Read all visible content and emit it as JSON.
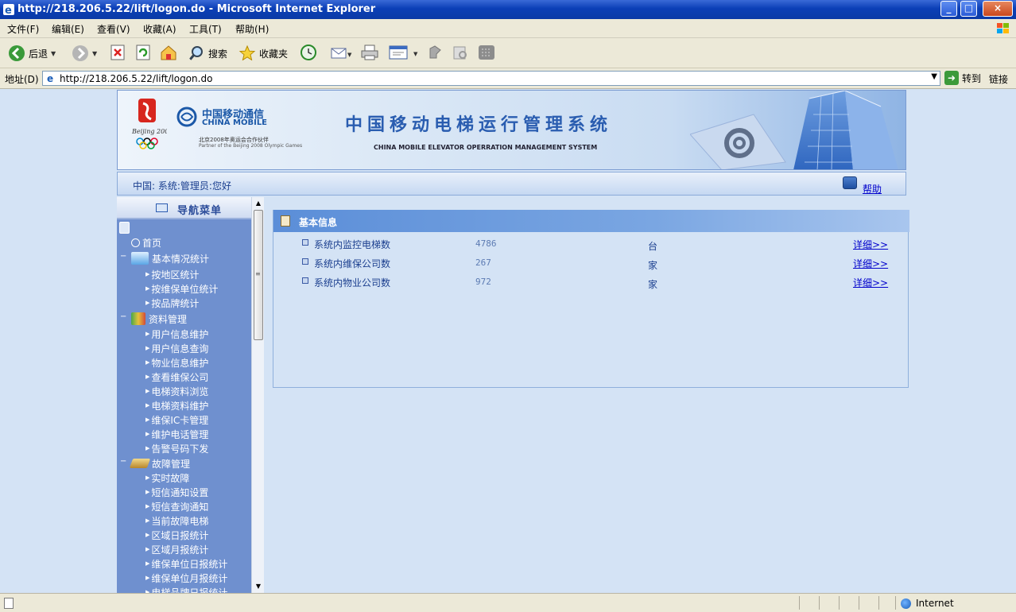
{
  "window": {
    "title": "http://218.206.5.22/lift/logon.do - Microsoft Internet Explorer",
    "min": "_",
    "max": "□",
    "close": "×"
  },
  "menu": [
    "文件(F)",
    "编辑(E)",
    "查看(V)",
    "收藏(A)",
    "工具(T)",
    "帮助(H)"
  ],
  "toolbar": {
    "back": "后退",
    "search": "搜索",
    "favorites": "收藏夹"
  },
  "address": {
    "label": "地址(D)",
    "url": "http://218.206.5.22/lift/logon.do",
    "go": "转到",
    "links": "链接"
  },
  "banner": {
    "cm_cn": "中国移动通信",
    "cm_en": "CHINA MOBILE",
    "cm_sub1": "北京2008年奥运会合作伙伴",
    "cm_sub2": "Partner of the Beijing 2008 Olympic Games",
    "title": "中国移动电梯运行管理系统",
    "title_en": "CHINA MOBILE ELEVATOR OPERRATION MANAGEMENT SYSTEM"
  },
  "infobar": {
    "greeting": "中国: 系统:管理员:您好",
    "help": "帮助"
  },
  "sidebar": {
    "title": "导航菜单",
    "home": "首页",
    "groups": [
      {
        "label": "基本情况统计",
        "items": [
          "按地区统计",
          "按维保单位统计",
          "按品牌统计"
        ]
      },
      {
        "label": "资料管理",
        "items": [
          "用户信息维护",
          "用户信息查询",
          "物业信息维护",
          "查看维保公司",
          "电梯资料浏览",
          "电梯资料维护",
          "维保IC卡管理",
          "维护电话管理",
          "告警号码下发"
        ]
      },
      {
        "label": "故障管理",
        "items": [
          "实时故障",
          "短信通知设置",
          "短信查询通知",
          "当前故障电梯",
          "区域日报统计",
          "区域月报统计",
          "维保单位日报统计",
          "维保单位月报统计",
          "电梯品牌日报统计"
        ]
      }
    ]
  },
  "panel": {
    "title": "基本信息",
    "rows": [
      {
        "label": "系统内监控电梯数",
        "value": "4786",
        "unit": "台",
        "link": "详细>>"
      },
      {
        "label": "系统内维保公司数",
        "value": "267",
        "unit": "家",
        "link": "详细>>"
      },
      {
        "label": "系统内物业公司数",
        "value": "972",
        "unit": "家",
        "link": "详细>>"
      }
    ]
  },
  "status": {
    "zone": "Internet"
  }
}
